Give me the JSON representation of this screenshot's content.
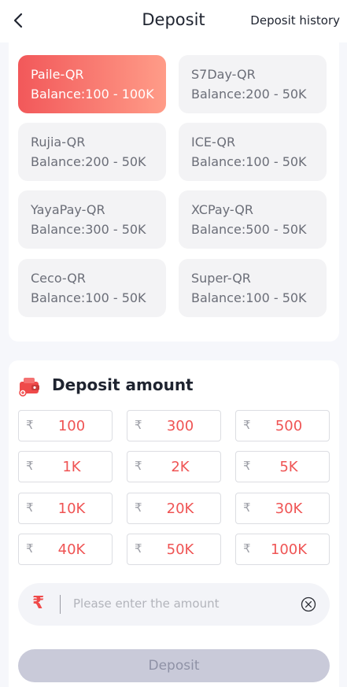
{
  "header": {
    "title": "Deposit",
    "history_label": "Deposit history"
  },
  "channels": [
    {
      "name": "Paile-QR",
      "balance": "Balance:100 - 100K",
      "active": true
    },
    {
      "name": "S7Day-QR",
      "balance": "Balance:200 - 50K",
      "active": false
    },
    {
      "name": "Rujia-QR",
      "balance": "Balance:200 - 50K",
      "active": false
    },
    {
      "name": "ICE-QR",
      "balance": "Balance:100 - 50K",
      "active": false
    },
    {
      "name": "YayaPay-QR",
      "balance": "Balance:300 - 50K",
      "active": false
    },
    {
      "name": "XCPay-QR",
      "balance": "Balance:500 - 50K",
      "active": false
    },
    {
      "name": "Ceco-QR",
      "balance": "Balance:100 - 50K",
      "active": false
    },
    {
      "name": "Super-QR",
      "balance": "Balance:100 - 50K",
      "active": false
    }
  ],
  "amount_section": {
    "title": "Deposit amount",
    "currency_symbol": "₹",
    "options": [
      "100",
      "300",
      "500",
      "1K",
      "2K",
      "5K",
      "10K",
      "20K",
      "30K",
      "40K",
      "50K",
      "100K"
    ]
  },
  "input": {
    "symbol": "₹",
    "placeholder": "Please enter the amount",
    "value": ""
  },
  "submit_label": "Deposit",
  "colors": {
    "accent": "#ef5454",
    "active_gradient_start": "#f2585a",
    "active_gradient_end": "#ff9c88",
    "disabled_button": "#c9cad9"
  }
}
